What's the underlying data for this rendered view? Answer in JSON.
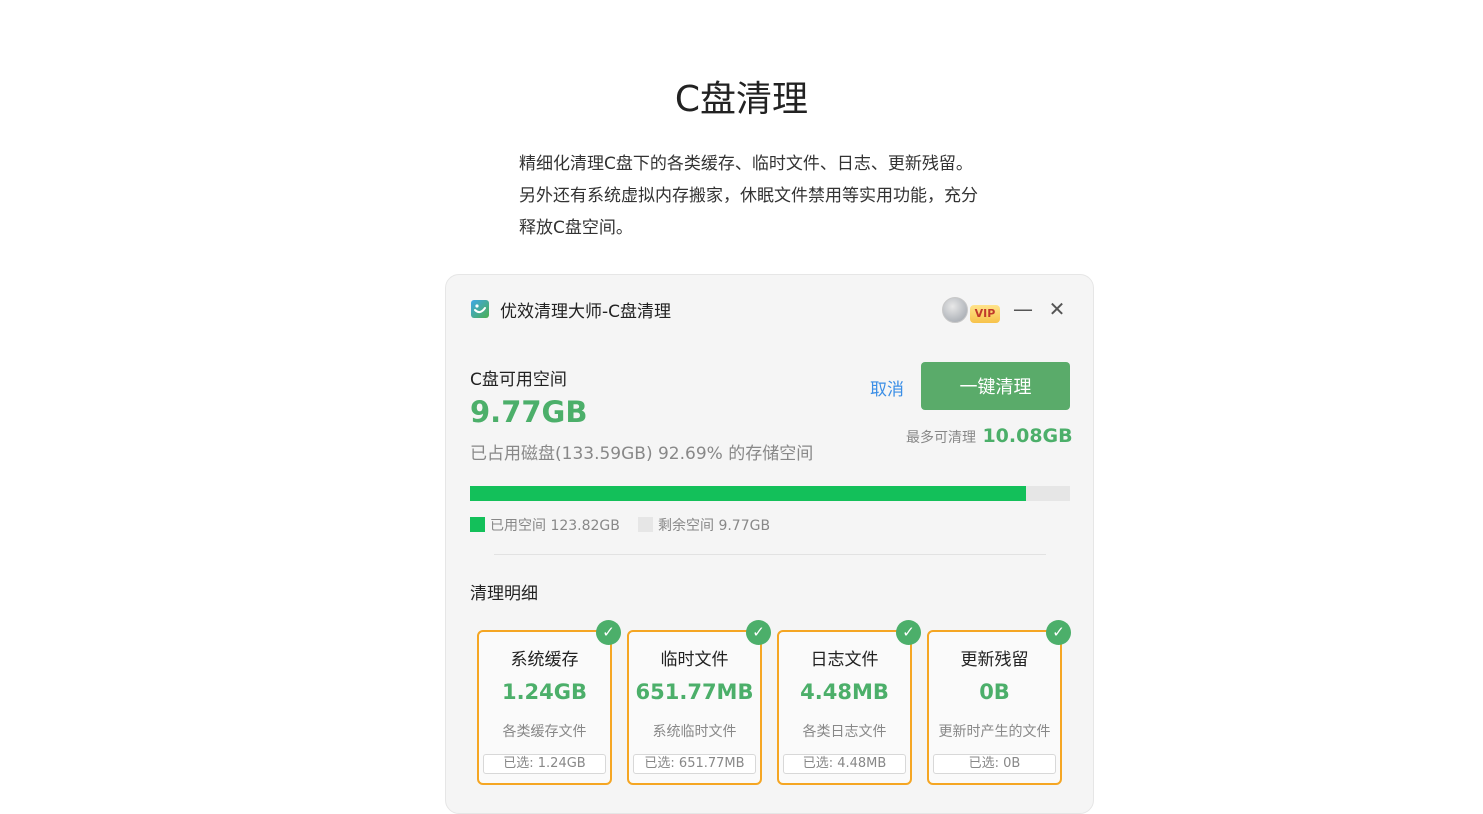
{
  "page": {
    "title": "C盘清理",
    "intro": [
      "精细化清理C盘下的各类缓存、临时文件、日志、更新残留。",
      "另外还有系统虚拟内存搬家，休眠文件禁用等实用功能，充分",
      "释放C盘空间。"
    ]
  },
  "window": {
    "title": "优效清理大师-C盘清理",
    "logo_icon": "app-logo-icon",
    "vip_label": "VIP",
    "minimize_glyph": "—",
    "close_glyph": "✕"
  },
  "disk": {
    "label": "C盘可用空间",
    "free_value": "9.77GB",
    "usage_text": "已占用磁盘(133.59GB) 92.69% 的存储空间",
    "used_fraction": 0.9269,
    "used_legend": "已用空间 123.82GB",
    "free_legend": "剩余空间 9.77GB",
    "used_color": "#13c05a",
    "free_color": "#e6e6e6"
  },
  "actions": {
    "cancel_label": "取消",
    "clean_label": "一键清理",
    "max_clean_label": "最多可清理",
    "max_clean_value": "10.08GB"
  },
  "details": {
    "title": "清理明细",
    "cards": [
      {
        "title": "系统缓存",
        "size": "1.24GB",
        "desc": "各类缓存文件",
        "selected": "已选: 1.24GB"
      },
      {
        "title": "临时文件",
        "size": "651.77MB",
        "desc": "系统临时文件",
        "selected": "已选: 651.77MB"
      },
      {
        "title": "日志文件",
        "size": "4.48MB",
        "desc": "各类日志文件",
        "selected": "已选: 4.48MB"
      },
      {
        "title": "更新残留",
        "size": "0B",
        "desc": "更新时产生的文件",
        "selected": "已选: 0B"
      }
    ]
  },
  "colors": {
    "accent_green": "#4caf6a",
    "button_green": "#5aab6a",
    "card_border": "#f5a623",
    "link_blue": "#3a8ee6"
  }
}
